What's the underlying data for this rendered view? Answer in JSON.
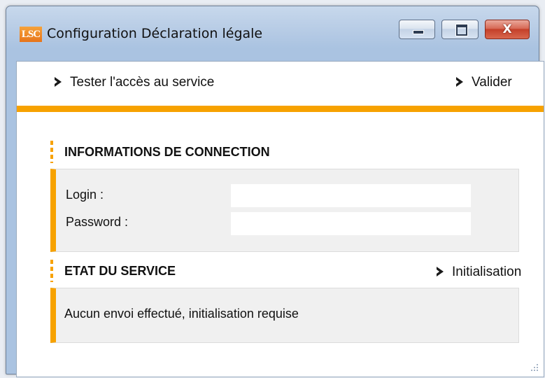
{
  "window": {
    "title": "Configuration Déclaration légale",
    "logo_text": "LSC",
    "buttons": {
      "minimize_icon": "minimize-icon",
      "maximize_icon": "maximize-icon",
      "close_icon": "close-icon",
      "close_glyph": "X"
    }
  },
  "toolbar": {
    "test_label": "Tester l'accès au service",
    "validate_label": "Valider",
    "chevron_icon": "chevron-right-icon"
  },
  "connection": {
    "title": "INFORMATIONS DE CONNECTION",
    "login_label": "Login :",
    "login_value": "",
    "password_label": "Password :",
    "password_value": ""
  },
  "service": {
    "title": "ETAT DU SERVICE",
    "init_label": "Initialisation",
    "status_text": "Aucun envoi effectué, initialisation requise"
  },
  "colors": {
    "accent": "#f7a200",
    "panel_bg": "#f0f0f0",
    "close_red": "#c4402a"
  }
}
